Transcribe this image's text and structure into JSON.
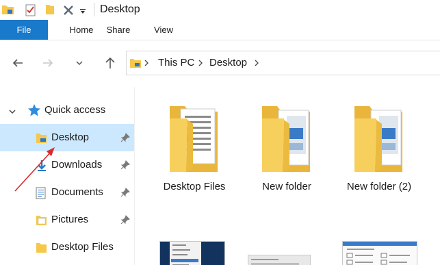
{
  "window": {
    "title": "Desktop"
  },
  "quick_access_toolbar": {
    "icons": [
      "folder-icon",
      "properties-check-icon",
      "new-folder-icon",
      "delete-x-icon",
      "customize-dropdown-icon"
    ]
  },
  "ribbon": {
    "tabs": [
      {
        "label": "File"
      },
      {
        "label": "Home"
      },
      {
        "label": "Share"
      },
      {
        "label": "View"
      }
    ]
  },
  "navigation": {
    "buttons": [
      "back-arrow-icon",
      "forward-arrow-icon",
      "recent-locations-chevron-icon",
      "up-arrow-icon"
    ],
    "breadcrumb": [
      "This PC",
      "Desktop"
    ]
  },
  "sidebar": {
    "header": "Quick access",
    "items": [
      {
        "label": "Desktop",
        "icon": "desktop-folder-icon",
        "pinned": true,
        "selected": true
      },
      {
        "label": "Downloads",
        "icon": "downloads-icon",
        "pinned": true,
        "selected": false
      },
      {
        "label": "Documents",
        "icon": "documents-icon",
        "pinned": true,
        "selected": false
      },
      {
        "label": "Pictures",
        "icon": "pictures-icon",
        "pinned": true,
        "selected": false
      },
      {
        "label": "Desktop Files",
        "icon": "folder-icon",
        "pinned": false,
        "selected": false
      }
    ]
  },
  "content": {
    "items": [
      {
        "label": "Desktop Files"
      },
      {
        "label": "New folder"
      },
      {
        "label": "New folder (2)"
      }
    ]
  },
  "colors": {
    "accent": "#1979ca",
    "selection": "#cce8ff",
    "folder": "#f5c84c",
    "annotation_arrow": "#d92b2b"
  }
}
